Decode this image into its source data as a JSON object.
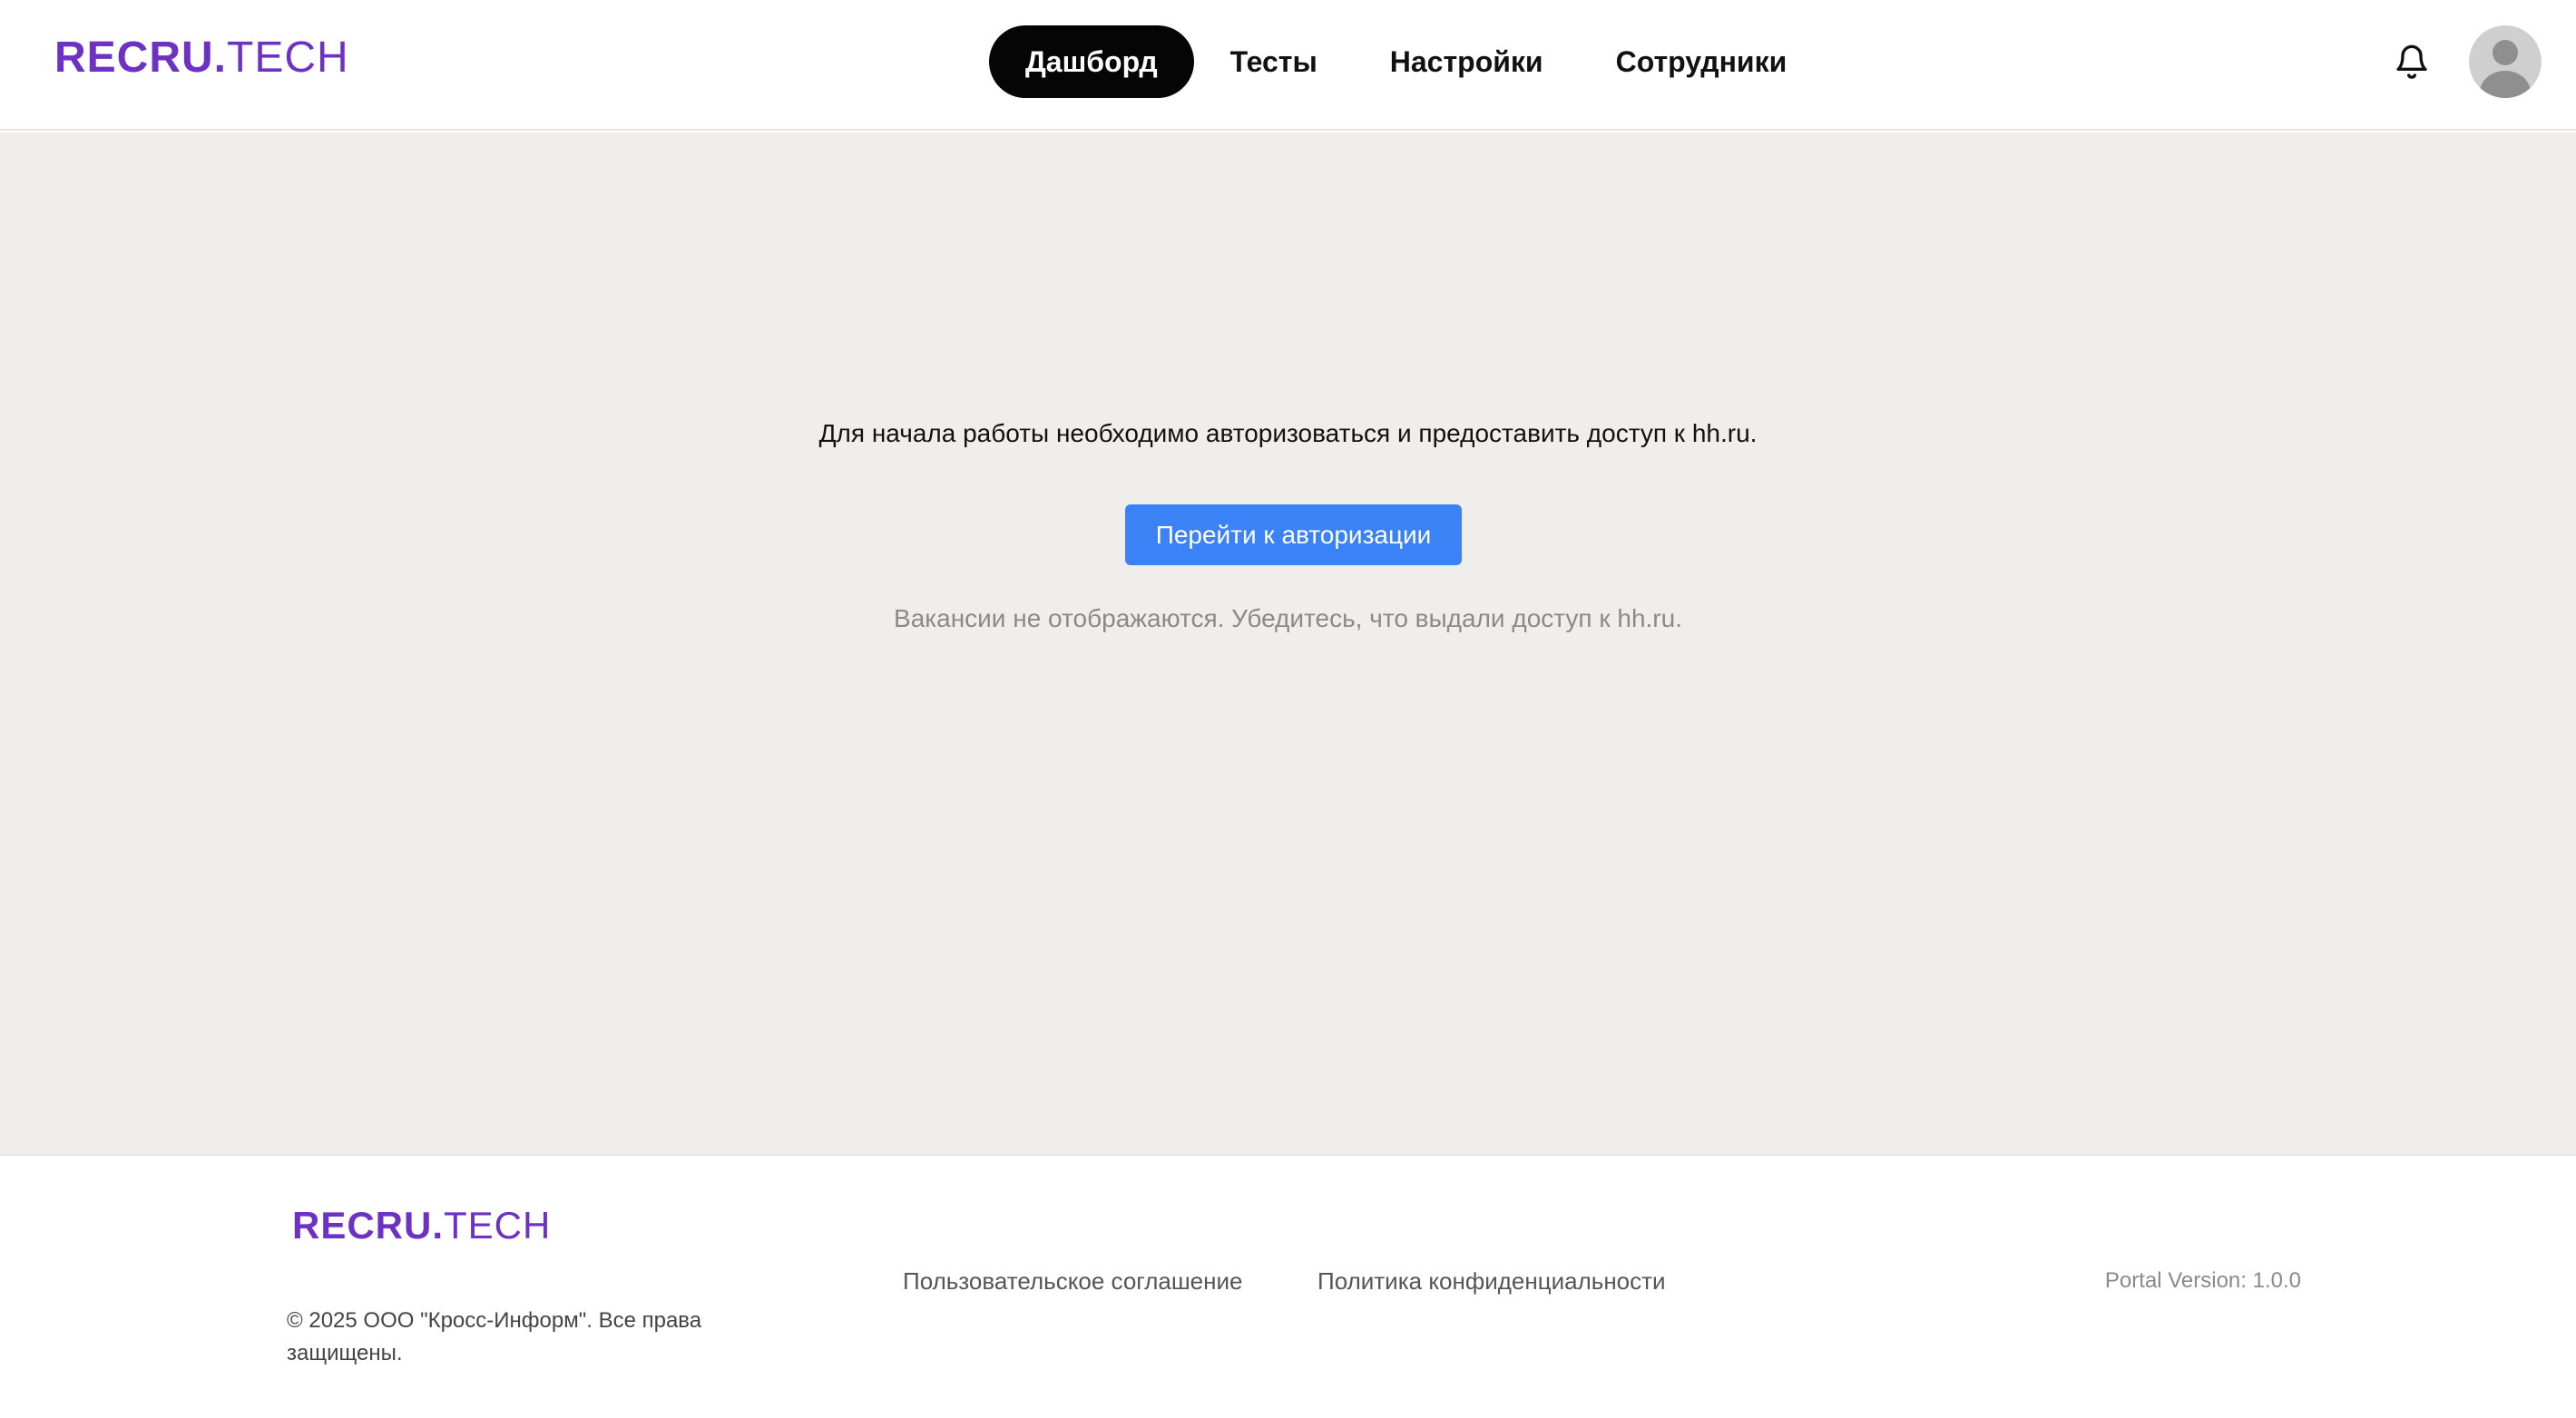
{
  "header": {
    "logo": {
      "bold": "RECRU.",
      "light": "TECH"
    },
    "nav": [
      {
        "label": "Дашборд",
        "active": true
      },
      {
        "label": "Тесты",
        "active": false
      },
      {
        "label": "Настройки",
        "active": false
      },
      {
        "label": "Сотрудники",
        "active": false
      }
    ],
    "icons": {
      "notifications": "bell-icon",
      "profile": "user-avatar-icon"
    }
  },
  "main": {
    "message": "Для начала работы необходимо авторизоваться и предоставить доступ к hh.ru.",
    "auth_button": "Перейти к авторизации",
    "hint": "Вакансии не отображаются. Убедитесь, что выдали доступ к hh.ru."
  },
  "footer": {
    "logo": {
      "bold": "RECRU.",
      "light": "TECH"
    },
    "copyright": "© 2025 ООО \"Кросс-Информ\". Все права защищены.",
    "links": [
      "Пользовательское соглашение",
      "Политика конфиденциальности"
    ],
    "version": "Portal Version: 1.0.0"
  },
  "colors": {
    "brand": "#6d32c4",
    "primary_button": "#3b82f6",
    "active_nav": "#050505",
    "main_background": "#efeeec"
  }
}
